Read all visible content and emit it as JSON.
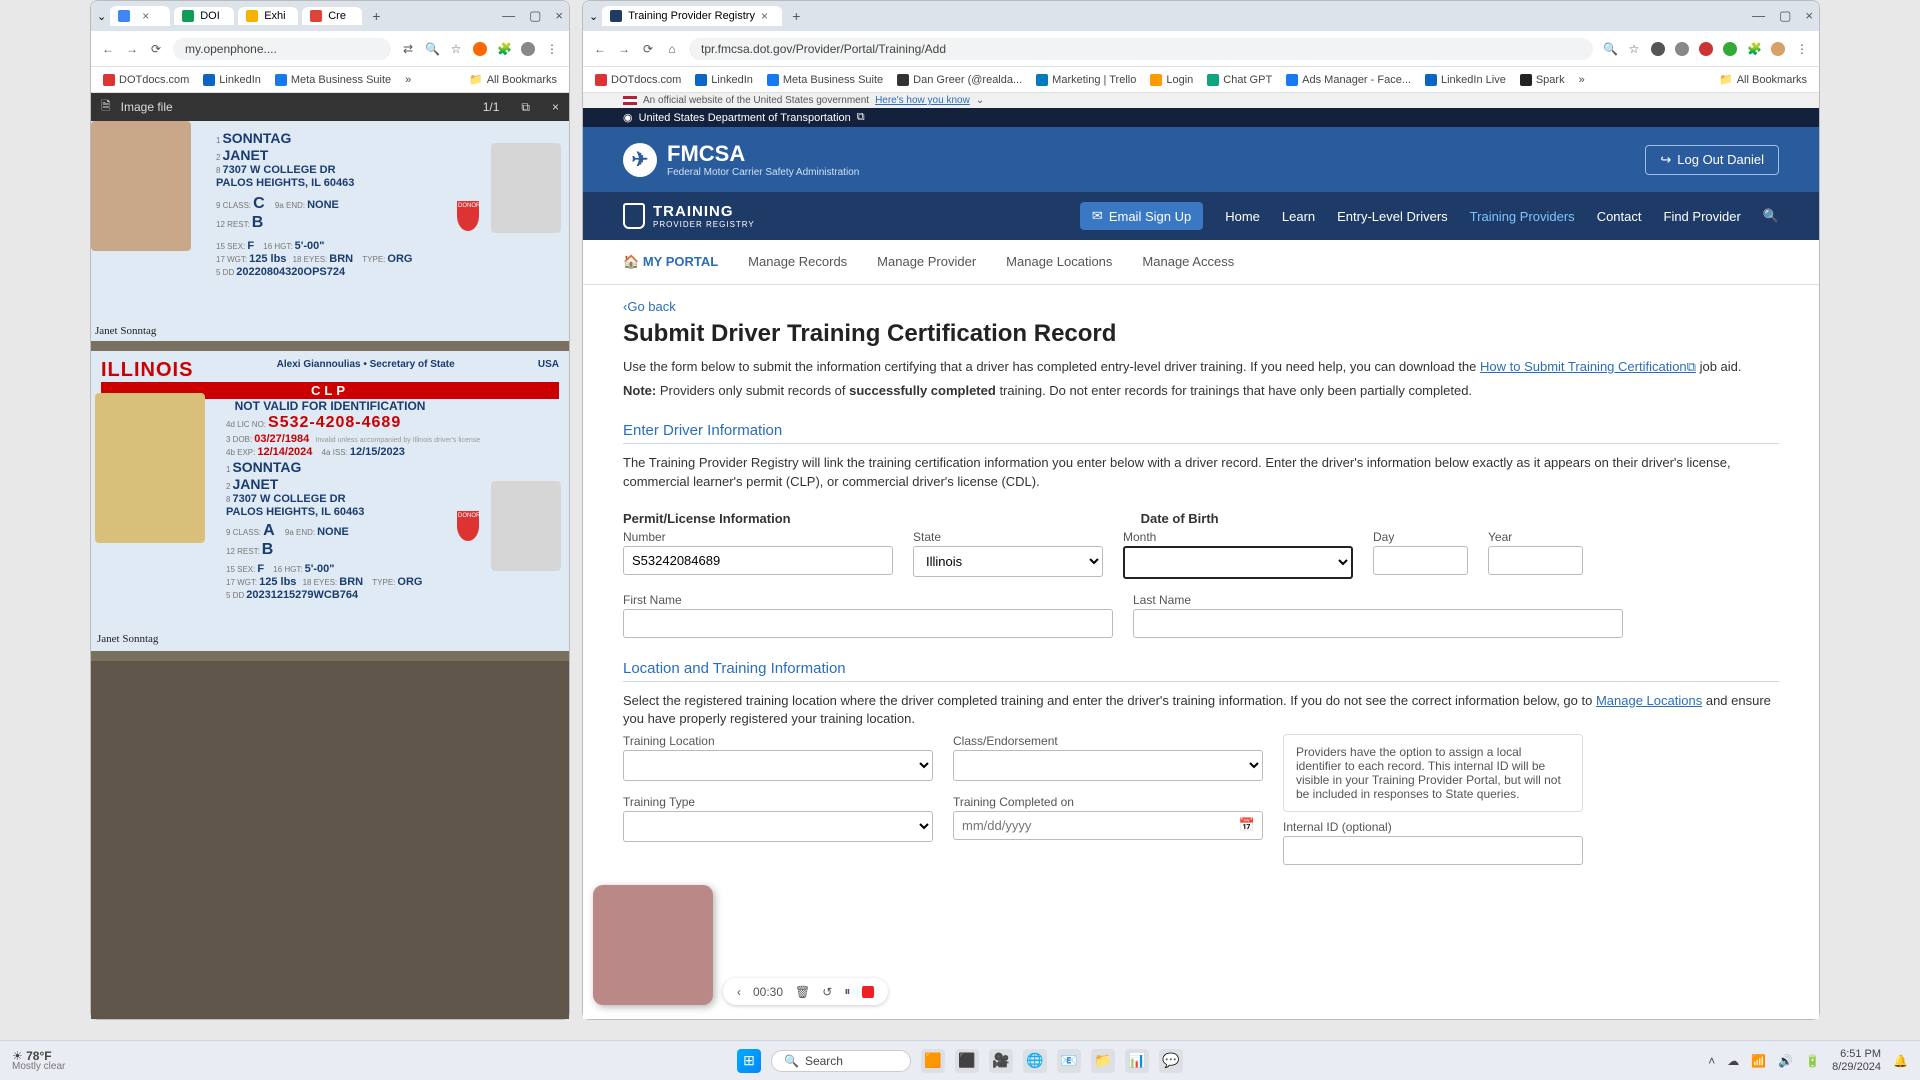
{
  "left_window": {
    "tabs": [
      {
        "fav": "#4285f4",
        "label": ""
      },
      {
        "fav": "#0f9d58",
        "label": "DOI"
      },
      {
        "fav": "#f4b400",
        "label": "Exhi"
      },
      {
        "fav": "#db4437",
        "label": "Cre"
      }
    ],
    "url": "my.openphone....",
    "bookmarks": [
      "DOTdocs.com",
      "LinkedIn",
      "Meta Business Suite"
    ],
    "all_bookmarks": "All Bookmarks",
    "viewer": {
      "title": "Image file",
      "page": "1/1"
    },
    "license1": {
      "last": "SONNTAG",
      "first": "JANET",
      "addr1": "7307 W COLLEGE DR",
      "addr2": "PALOS HEIGHTS, IL 60463",
      "class_lbl": "9 CLASS:",
      "class": "C",
      "end_lbl": "9a END:",
      "end": "NONE",
      "rest_lbl": "12 REST:",
      "rest": "B",
      "sex_lbl": "15 SEX:",
      "sex": "F",
      "hgt_lbl": "16 HGT:",
      "hgt": "5'-00\"",
      "wgt_lbl": "17 WGT:",
      "wgt": "125 lbs",
      "eyes_lbl": "18 EYES:",
      "eyes": "BRN",
      "type_lbl": "TYPE:",
      "type": "ORG",
      "dd_lbl": "5 DD",
      "dd": "20220804320OPS724",
      "sig": "Janet Sonntag"
    },
    "license2": {
      "state": "ILLINOIS",
      "sos": "Alexi Giannoulias • Secretary of State",
      "usa": "USA",
      "clp": "CLP",
      "nvid": "NOT VALID FOR IDENTIFICATION",
      "licno_lbl": "4d LIC NO:",
      "licno": "S532-4208-4689",
      "dob_lbl": "3 DOB:",
      "dob": "03/27/1984",
      "inv": "Invalid unless accompanied by Illinois driver's license",
      "exp_lbl": "4b EXP:",
      "exp": "12/14/2024",
      "iss_lbl": "4a ISS:",
      "iss": "12/15/2023",
      "last": "SONNTAG",
      "first": "JANET",
      "addr1": "7307 W COLLEGE DR",
      "addr2": "PALOS HEIGHTS, IL 60463",
      "class_lbl": "9 CLASS:",
      "class": "A",
      "end_lbl": "9a END:",
      "end": "NONE",
      "rest_lbl": "12 REST:",
      "rest": "B",
      "sex_lbl": "15 SEX:",
      "sex": "F",
      "hgt_lbl": "16 HGT:",
      "hgt": "5'-00\"",
      "wgt_lbl": "17 WGT:",
      "wgt": "125 lbs",
      "eyes_lbl": "18 EYES:",
      "eyes": "BRN",
      "type_lbl": "TYPE:",
      "type": "ORG",
      "dd_lbl": "5 DD",
      "dd": "20231215279WCB764",
      "sig": "Janet Sonntag"
    }
  },
  "right_window": {
    "tab": {
      "fav": "#1d3b66",
      "label": "Training Provider Registry"
    },
    "url": "tpr.fmcsa.dot.gov/Provider/Portal/Training/Add",
    "bookmarks": [
      "DOTdocs.com",
      "LinkedIn",
      "Meta Business Suite",
      "Dan Greer (@realda...",
      "Marketing | Trello",
      "Login",
      "Chat GPT",
      "Ads Manager - Face...",
      "LinkedIn Live",
      "Spark"
    ],
    "all_bookmarks": "All Bookmarks",
    "gov_banner": {
      "text": "An official website of the United States government",
      "link": "Here's how you know"
    },
    "dot_bar": "United States Department of Transportation",
    "fmcsa": {
      "title": "FMCSA",
      "sub": "Federal Motor Carrier Safety Administration",
      "logout": "Log Out Daniel"
    },
    "tpr_brand": {
      "t1": "TRAINING",
      "t2": "PROVIDER REGISTRY"
    },
    "signup": "Email Sign Up",
    "nav": {
      "home": "Home",
      "learn": "Learn",
      "eld": "Entry-Level Drivers",
      "tp": "Training Providers",
      "contact": "Contact",
      "find": "Find Provider"
    },
    "subnav": {
      "portal": "MY PORTAL",
      "mrec": "Manage Records",
      "mprov": "Manage Provider",
      "mloc": "Manage Locations",
      "macc": "Manage Access"
    },
    "goback": "Go back",
    "h1": "Submit Driver Training Certification Record",
    "intro1a": "Use the form below to submit the information certifying that a driver has completed entry-level driver training. If you need help, you can download the ",
    "intro1link": "How to Submit Training Certification",
    "intro1b": " job aid.",
    "note_lbl": "Note:",
    "note_a": " Providers only submit records of ",
    "note_b": "successfully completed",
    "note_c": " training. Do not enter records for trainings that have only been partially completed.",
    "sec1": "Enter Driver Information",
    "sec1_p": "The Training Provider Registry will link the training certification information you enter below with a driver record. Enter the driver's information below exactly as it appears on their driver's license, commercial learner's permit (CLP), or commercial driver's license (CDL).",
    "pl_info": "Permit/License Information",
    "dob": "Date of Birth",
    "lbl": {
      "number": "Number",
      "state": "State",
      "month": "Month",
      "day": "Day",
      "year": "Year",
      "first": "First Name",
      "last": "Last Name",
      "loc": "Training Location",
      "cls": "Class/Endorsement",
      "ttype": "Training Type",
      "tcomp": "Training Completed on",
      "iid": "Internal ID (optional)"
    },
    "val": {
      "number": "S53242084689",
      "state": "Illinois",
      "tcomp_ph": "mm/dd/yyyy"
    },
    "sec2": "Location and Training Information",
    "sec2_p1": "Select the registered training location where the driver completed training and enter the driver's training information. If you do not see the correct information below, go to ",
    "sec2_link": "Manage Locations",
    "sec2_p2": " and ensure you have properly registered your training location.",
    "infobox": "Providers have the option to assign a local identifier to each record. This internal ID will be visible in your Training Provider Portal, but will not be included in responses to State queries."
  },
  "recorder": {
    "time": "00:30"
  },
  "taskbar": {
    "temp": "78°F",
    "cond": "Mostly clear",
    "search_ph": "Search",
    "time": "6:51 PM",
    "date": "8/29/2024"
  }
}
